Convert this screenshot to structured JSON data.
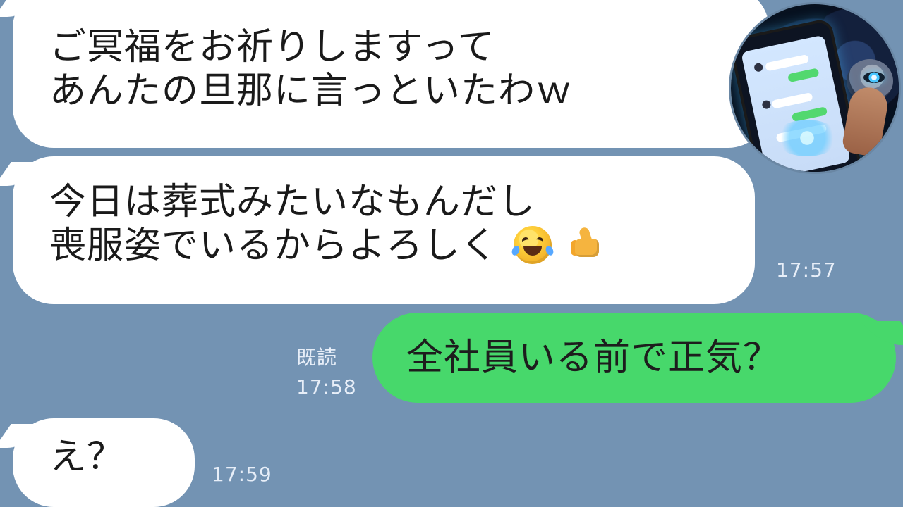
{
  "theme": {
    "background": "#7393b3",
    "incoming_bubble": "#ffffff",
    "outgoing_bubble": "#47d86b",
    "meta_text": "#e7eef8"
  },
  "messages": [
    {
      "lines": [
        "ご冥福をお祈りしますって",
        "あんたの旦那に言っといたわｗ"
      ]
    },
    {
      "lines": [
        "今日は葬式みたいなもんだし",
        "喪服姿でいるからよろしく"
      ],
      "emoji": [
        "rolling-on-the-floor-laughing-icon",
        "thumbs-up-icon"
      ],
      "time": "17:57"
    },
    {
      "read_label": "既読",
      "time": "17:58",
      "text": "全社員いる前で正気？"
    },
    {
      "text": "え？",
      "time": "17:59"
    }
  ],
  "overlay": {
    "icon": "spy-phone-badge-icon"
  }
}
